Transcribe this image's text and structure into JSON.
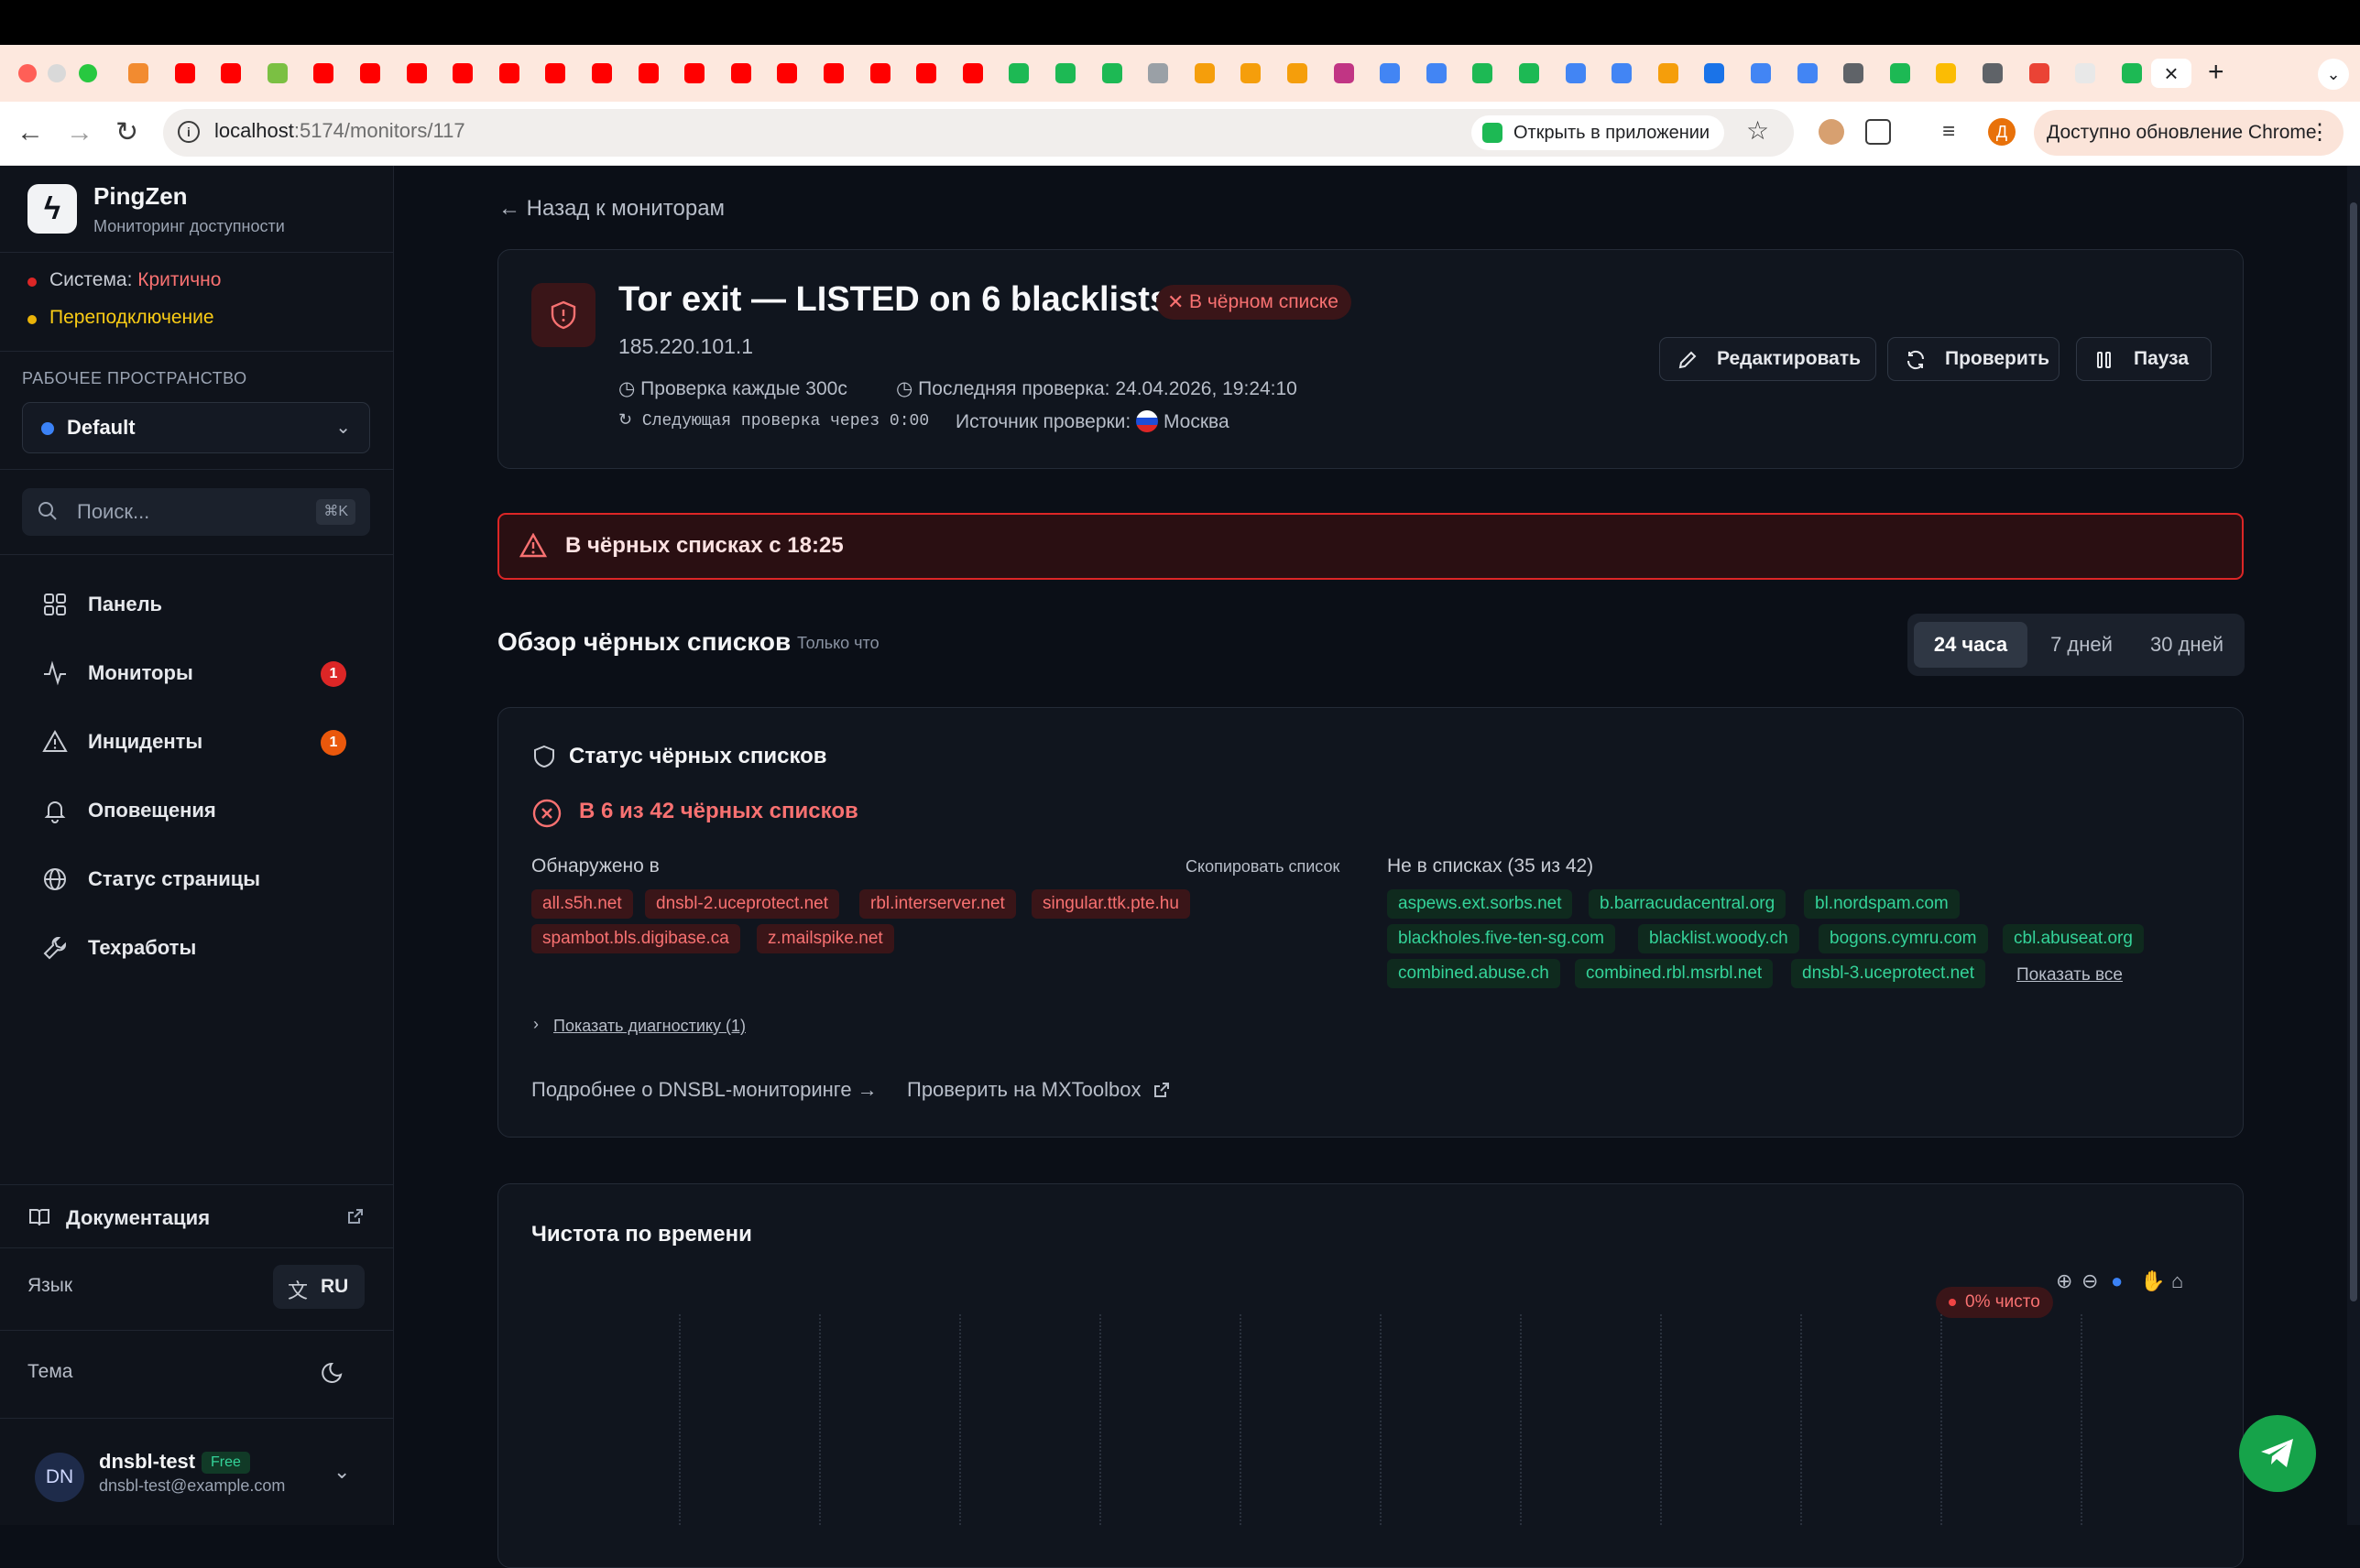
{
  "browser": {
    "url_host": "localhost",
    "url_path": ":5174/monitors/117",
    "open_in_app": "Открыть в приложении",
    "update_chrome": "Доступно обновление Chrome",
    "profile_initial": "Д",
    "tab_close": "×",
    "new_tab": "+"
  },
  "sidebar": {
    "app_name": "PingZen",
    "app_subtitle": "Мониторинг доступности",
    "system_label": "Система: ",
    "system_status": "Критично",
    "reconnect": "Переподключение",
    "workspace_label": "РАБОЧЕЕ ПРОСТРАНСТВО",
    "workspace_value": "Default",
    "search_placeholder": "Поиск...",
    "search_shortcut": "⌘K",
    "nav": [
      {
        "label": "Панель",
        "icon": "dashboard-icon"
      },
      {
        "label": "Мониторы",
        "icon": "activity-icon",
        "badge": "1"
      },
      {
        "label": "Инциденты",
        "icon": "warning-icon",
        "badge": "1"
      },
      {
        "label": "Оповещения",
        "icon": "bell-icon"
      },
      {
        "label": "Статус страницы",
        "icon": "globe-icon"
      },
      {
        "label": "Техработы",
        "icon": "wrench-icon"
      }
    ],
    "docs": "Документация",
    "language_label": "Язык",
    "language_value": "RU",
    "theme_label": "Тема",
    "user": {
      "initials": "DN",
      "name": "dnsbl-test",
      "plan": "Free",
      "email": "dnsbl-test@example.com"
    }
  },
  "monitor": {
    "back": "Назад к мониторам",
    "title": "Tor exit — LISTED on 6 blacklists",
    "status_badge": "В чёрном списке",
    "ip": "185.220.101.1",
    "check_interval": "Проверка каждые 300с",
    "last_check": "Последняя проверка: 24.04.2026, 19:24:10",
    "next_check": "Следующая проверка через 0:00",
    "source_label": "Источник проверки:",
    "source_value": "Москва",
    "edit": "Редактировать",
    "check": "Проверить",
    "pause": "Пауза"
  },
  "alert": {
    "text": "В чёрных списках с 18:25"
  },
  "overview": {
    "title": "Обзор чёрных списков",
    "updated": "Только что",
    "ranges": [
      "24 часа",
      "7 дней",
      "30 дней"
    ],
    "active_range": "24 часа"
  },
  "blacklist": {
    "title": "Статус чёрных списков",
    "summary": "В 6 из 42 чёрных списков",
    "found_label": "Обнаружено в",
    "copy_list": "Скопировать список",
    "listed": [
      "all.s5h.net",
      "dnsbl-2.uceprotect.net",
      "rbl.interserver.net",
      "singular.ttk.pte.hu",
      "spambot.bls.digibase.ca",
      "z.mailspike.net"
    ],
    "not_listed_label": "Не в списках (35 из 42)",
    "not_listed": [
      "aspews.ext.sorbs.net",
      "b.barracudacentral.org",
      "bl.nordspam.com",
      "blackholes.five-ten-sg.com",
      "blacklist.woody.ch",
      "bogons.cymru.com",
      "cbl.abuseat.org",
      "combined.abuse.ch",
      "combined.rbl.msrbl.net",
      "dnsbl-3.uceprotect.net"
    ],
    "show_all": "Показать все",
    "diagnostics": "Показать диагностику (1)",
    "learn_more": "Подробнее о DNSBL-мониторинге →",
    "mxtoolbox": "Проверить на MXToolbox"
  },
  "chart": {
    "title": "Чистота по времени",
    "badge": "0% чисто"
  },
  "colors": {
    "accent_red": "#f87171",
    "accent_green": "#34d399",
    "warning": "#facc15",
    "brand_green": "#16a34a"
  }
}
